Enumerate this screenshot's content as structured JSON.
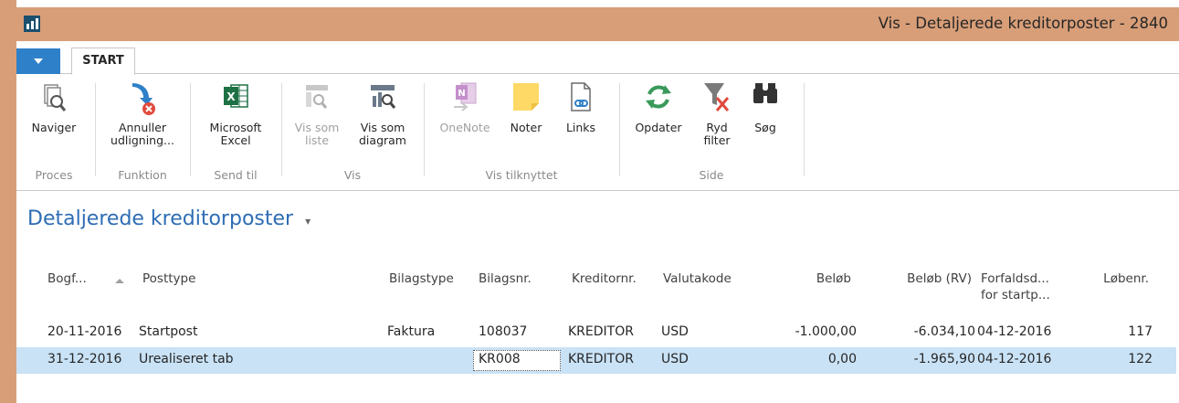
{
  "window": {
    "title": "Vis - Detaljerede kreditorposter - 2840"
  },
  "tabs": {
    "start": "START"
  },
  "ribbon": {
    "groups": [
      {
        "label": "Proces",
        "buttons": [
          {
            "label": "Naviger",
            "icon": "navigate-icon"
          }
        ]
      },
      {
        "label": "Funktion",
        "buttons": [
          {
            "label": "Annuller\nudligning...",
            "icon": "cancel-apply-icon"
          }
        ]
      },
      {
        "label": "Send til",
        "buttons": [
          {
            "label": "Microsoft\nExcel",
            "icon": "excel-icon"
          }
        ]
      },
      {
        "label": "Vis",
        "buttons": [
          {
            "label": "Vis som\nliste",
            "icon": "list-view-icon",
            "disabled": true
          },
          {
            "label": "Vis som\ndiagram",
            "icon": "chart-view-icon"
          }
        ]
      },
      {
        "label": "Vis tilknyttet",
        "buttons": [
          {
            "label": "OneNote",
            "icon": "onenote-icon",
            "disabled": true
          },
          {
            "label": "Noter",
            "icon": "notes-icon"
          },
          {
            "label": "Links",
            "icon": "links-icon"
          }
        ]
      },
      {
        "label": "Side",
        "buttons": [
          {
            "label": "Opdater",
            "icon": "refresh-icon"
          },
          {
            "label": "Ryd\nfilter",
            "icon": "clear-filter-icon"
          },
          {
            "label": "Søg",
            "icon": "binoculars-icon"
          }
        ]
      }
    ]
  },
  "page": {
    "title": "Detaljerede kreditorposter",
    "title_menu": "▾"
  },
  "table": {
    "columns": [
      {
        "key": "bogf",
        "label": "Bogf..."
      },
      {
        "key": "posttype",
        "label": "Posttype"
      },
      {
        "key": "bilagstype",
        "label": "Bilagstype"
      },
      {
        "key": "bilagsnr",
        "label": "Bilagsnr."
      },
      {
        "key": "kreditornr",
        "label": "Kreditornr."
      },
      {
        "key": "valutakode",
        "label": "Valutakode"
      },
      {
        "key": "belob",
        "label": "Beløb"
      },
      {
        "key": "belob_rv",
        "label": "Beløb (RV)"
      },
      {
        "key": "forfald",
        "label": "Forfaldsd...\nfor startp..."
      },
      {
        "key": "lobenr",
        "label": "Løbenr."
      }
    ],
    "rows": [
      {
        "bogf": "20-11-2016",
        "posttype": "Startpost",
        "bilagstype": "Faktura",
        "bilagsnr": "108037",
        "kreditornr": "KREDITOR",
        "valutakode": "USD",
        "belob": "-1.000,00",
        "belob_rv": "-6.034,10",
        "forfald": "04-12-2016",
        "lobenr": "117",
        "selected": false
      },
      {
        "bogf": "31-12-2016",
        "posttype": "Urealiseret tab",
        "bilagstype": "",
        "bilagsnr": "KR008",
        "kreditornr": "KREDITOR",
        "valutakode": "USD",
        "belob": "0,00",
        "belob_rv": "-1.965,90",
        "forfald": "04-12-2016",
        "lobenr": "122",
        "selected": true
      }
    ]
  },
  "colors": {
    "titlebar": "#d89e78",
    "accent": "#2e80c8",
    "selection": "#c9e2f6",
    "page_title": "#2e6db4"
  }
}
